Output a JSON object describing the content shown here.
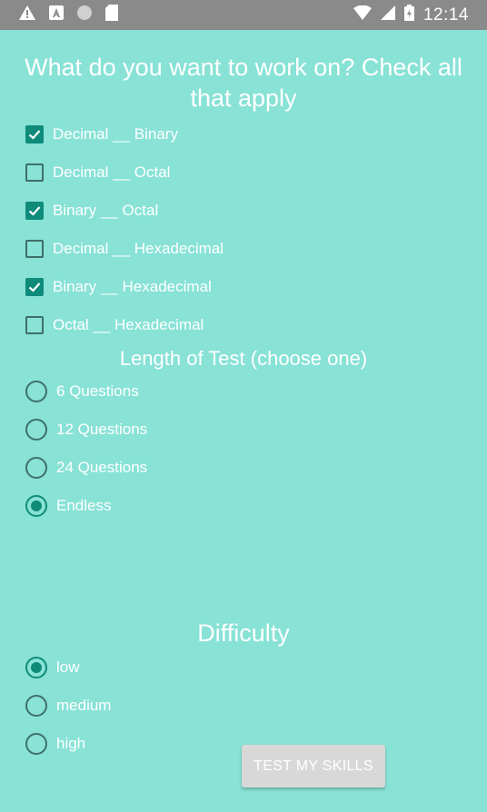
{
  "status_bar": {
    "time": "12:14"
  },
  "question_title": "What do you want to work on? Check all that apply",
  "conversions": [
    {
      "label": "Decimal __ Binary",
      "checked": true
    },
    {
      "label": "Decimal __ Octal",
      "checked": false
    },
    {
      "label": "Binary __ Octal",
      "checked": true
    },
    {
      "label": "Decimal __ Hexadecimal",
      "checked": false
    },
    {
      "label": "Binary __ Hexadecimal",
      "checked": true
    },
    {
      "label": "Octal __ Hexadecimal",
      "checked": false
    }
  ],
  "length_title": "Length of Test (choose one)",
  "lengths": [
    {
      "label": "6 Questions",
      "selected": false
    },
    {
      "label": "12 Questions",
      "selected": false
    },
    {
      "label": "24 Questions",
      "selected": false
    },
    {
      "label": "Endless",
      "selected": true
    }
  ],
  "difficulty_title": "Difficulty",
  "difficulties": [
    {
      "label": "low",
      "selected": true
    },
    {
      "label": "medium",
      "selected": false
    },
    {
      "label": "high",
      "selected": false
    }
  ],
  "submit_label": "TEST MY SKILLS",
  "colors": {
    "background": "#88E2D6",
    "accent": "#0f8b7a",
    "statusbar": "#8a8a8a"
  }
}
